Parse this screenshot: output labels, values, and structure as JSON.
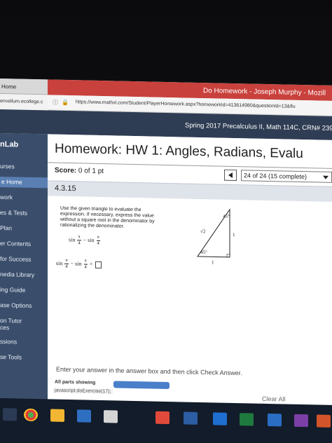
{
  "left_window": {
    "title": "Home",
    "url": "envellum.ecollege.c"
  },
  "browser": {
    "title": "Do Homework - Joseph Murphy - Mozill",
    "url": "https://www.mathxl.com/Student/PlayerHomework.aspx?homeworkId=413614980&questionId=13&flu"
  },
  "header": {
    "course": "Spring 2017 Precalculus II, Math 114C, CRN# 239"
  },
  "sidebar": {
    "brand": "nLab",
    "items": [
      "urses",
      "e Home",
      "work",
      "es & Tests",
      "Plan",
      "er Contents",
      "for Success",
      "nedia Library",
      "ing Guide",
      "ase Options",
      "on Tutor",
      "ces",
      "ssions",
      "se Tools"
    ]
  },
  "main": {
    "title": "Homework: HW 1: Angles, Radians, Evalu",
    "score_label": "Score:",
    "score_value": "0 of 1 pt",
    "question_nav": "24 of 24 (15 complete)",
    "question_number": "4.3.15",
    "instructions": "Use the given triangle to evaluate the expression. If necessary, express the value without a square root in the denominator by rationalizing the denominator.",
    "expr": {
      "fn": "sin",
      "minus": "−",
      "num": "π",
      "den": "4",
      "eq": "="
    },
    "triangle": {
      "hyp": "√2",
      "side": "1",
      "base": "1",
      "angle_top": "45°",
      "angle_left": "45°"
    },
    "footer_instruction": "Enter your answer in the answer box and then click Check Answer.",
    "all_parts": "All parts showing",
    "status_url": "javascript:doExercise(17);",
    "clear_all": "Clear All"
  },
  "colors": {
    "title_bar": "#c9413c",
    "header": "#2f3d54",
    "sidebar": "#3a4e6b",
    "sidebar_active": "#5a7fb3",
    "progress": "#4a7fc9",
    "taskbar": "#121c2a"
  },
  "taskbar": {
    "icons": [
      "start-icon",
      "chrome-icon",
      "explorer-icon",
      "store-icon",
      "lenovo-icon",
      "mail-icon",
      "excel-icon",
      "outlook-icon",
      "onenote-icon",
      "powerpoint-icon"
    ]
  }
}
